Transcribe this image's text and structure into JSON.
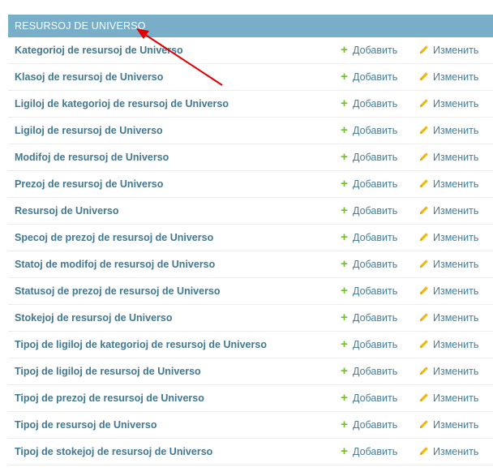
{
  "module": {
    "caption": "RESURSOJ DE UNIVERSO",
    "add_label": "Добавить",
    "change_label": "Изменить",
    "icons": {
      "add": "plus-icon",
      "change": "pencil-icon"
    },
    "colors": {
      "caption_bg": "#79aec8",
      "link": "#417893",
      "add_icon": "#70bf2b",
      "change_icon": "#efb80b",
      "annotation_arrow": "#e00000"
    },
    "rows": [
      {
        "name": "Kategorioj de resursoj de Universo"
      },
      {
        "name": "Klasoj de resursoj de Universo"
      },
      {
        "name": "Ligiloj de kategorioj de resursoj de Universo"
      },
      {
        "name": "Ligiloj de resursoj de Universo"
      },
      {
        "name": "Modifoj de resursoj de Universo"
      },
      {
        "name": "Prezoj de resursoj de Universo"
      },
      {
        "name": "Resursoj de Universo"
      },
      {
        "name": "Specoj de prezoj de resursoj de Universo"
      },
      {
        "name": "Statoj de modifoj de resursoj de Universo"
      },
      {
        "name": "Statusoj de prezoj de resursoj de Universo"
      },
      {
        "name": "Stokejoj de resursoj de Universo"
      },
      {
        "name": "Tipoj de ligiloj de kategorioj de resursoj de Universo"
      },
      {
        "name": "Tipoj de ligiloj de resursoj de Universo"
      },
      {
        "name": "Tipoj de prezoj de resursoj de Universo"
      },
      {
        "name": "Tipoj de resursoj de Universo"
      },
      {
        "name": "Tipoj de stokejoj de resursoj de Universo"
      }
    ]
  }
}
